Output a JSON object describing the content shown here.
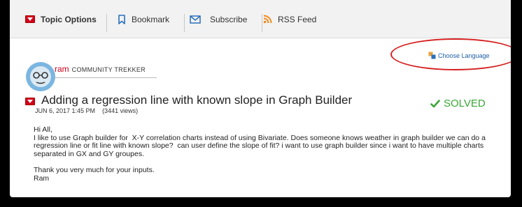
{
  "toolbar": {
    "topic_options": "Topic Options",
    "bookmark": "Bookmark",
    "subscribe": "Subscribe",
    "rss_feed": "RSS Feed"
  },
  "language": {
    "label": "Choose Language"
  },
  "author": {
    "name": "ram",
    "rank": "COMMUNITY TREKKER"
  },
  "post": {
    "title": "Adding a regression line with known slope in Graph Builder",
    "date": "JUN 6, 2017 1:45 PM",
    "views": "(3441 views)",
    "status": "SOLVED",
    "body_lines": [
      "Hi All,",
      "I like to use Graph builder for  X-Y correlation charts instead of using Bivariate. Does someone knows weather in graph builder we can do a",
      "regression line or fit line with known slope?  can user define the slope of fit? i want to use graph builder since i want to have multiple charts",
      "separated in GX and GY groupes.",
      "",
      "Thank you very much for your inputs.",
      "Ram"
    ]
  },
  "colors": {
    "accent_red": "#d0021b",
    "link_blue": "#1d5ea8",
    "solved_green": "#3aa636",
    "annotation_red": "#d61f1f"
  }
}
